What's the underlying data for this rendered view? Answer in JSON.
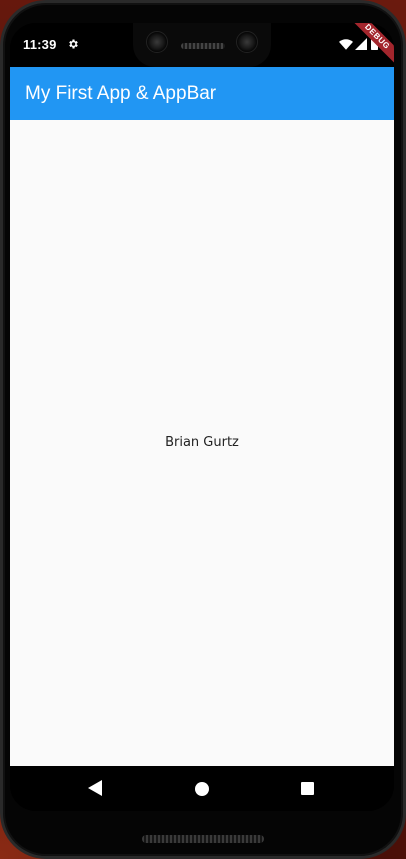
{
  "status_bar": {
    "time": "11:39",
    "icons": [
      "gear-icon",
      "wifi-icon",
      "signal-icon",
      "battery-icon"
    ]
  },
  "debug_banner": {
    "label": "DEBUG",
    "color": "#a3262d"
  },
  "app_bar": {
    "title": "My First App & AppBar",
    "color": "#2196f3"
  },
  "body": {
    "center_text": "Brian Gurtz",
    "background": "#fafafa"
  },
  "nav_bar": {
    "buttons": [
      "back-icon",
      "home-icon",
      "recents-icon"
    ]
  }
}
